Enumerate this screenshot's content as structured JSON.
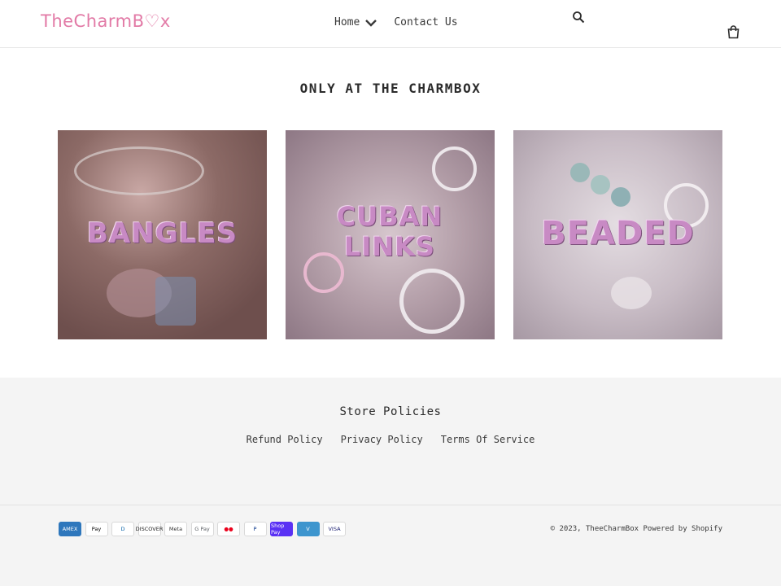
{
  "header": {
    "logo": "TheCharmB♡x",
    "nav": [
      {
        "label": "Home"
      },
      {
        "label": "Contact Us"
      }
    ]
  },
  "main": {
    "title": "ONLY AT THE CHARMBOX",
    "collections": [
      {
        "label": "BANGLES"
      },
      {
        "label": "CUBAN LINKS"
      },
      {
        "label": "BEADED"
      }
    ]
  },
  "footer": {
    "title": "Store Policies",
    "links": [
      "Refund Policy",
      "Privacy Policy",
      "Terms Of Service"
    ],
    "payments": [
      {
        "name": "AMEX",
        "bg": "#2e77bc",
        "fg": "#ffffff"
      },
      {
        "name": "Pay",
        "bg": "#ffffff",
        "fg": "#000000"
      },
      {
        "name": "D",
        "bg": "#ffffff",
        "fg": "#0a63a8"
      },
      {
        "name": "DISCOVER",
        "bg": "#ffffff",
        "fg": "#222222"
      },
      {
        "name": "Meta",
        "bg": "#ffffff",
        "fg": "#333333"
      },
      {
        "name": "G Pay",
        "bg": "#ffffff",
        "fg": "#5f6368"
      },
      {
        "name": "●●",
        "bg": "#ffffff",
        "fg": "#eb001b"
      },
      {
        "name": "P",
        "bg": "#ffffff",
        "fg": "#003087"
      },
      {
        "name": "Shop Pay",
        "bg": "#5a31f4",
        "fg": "#ffffff"
      },
      {
        "name": "V",
        "bg": "#3d95ce",
        "fg": "#ffffff"
      },
      {
        "name": "VISA",
        "bg": "#ffffff",
        "fg": "#1a1f71"
      }
    ],
    "copyright": "© 2023, TheeCharmBox",
    "powered": "Powered by Shopify"
  },
  "colors": {
    "brand": "#e27aa6",
    "label_pink": "#c88ac4",
    "footer_bg": "#f4f4f4"
  }
}
